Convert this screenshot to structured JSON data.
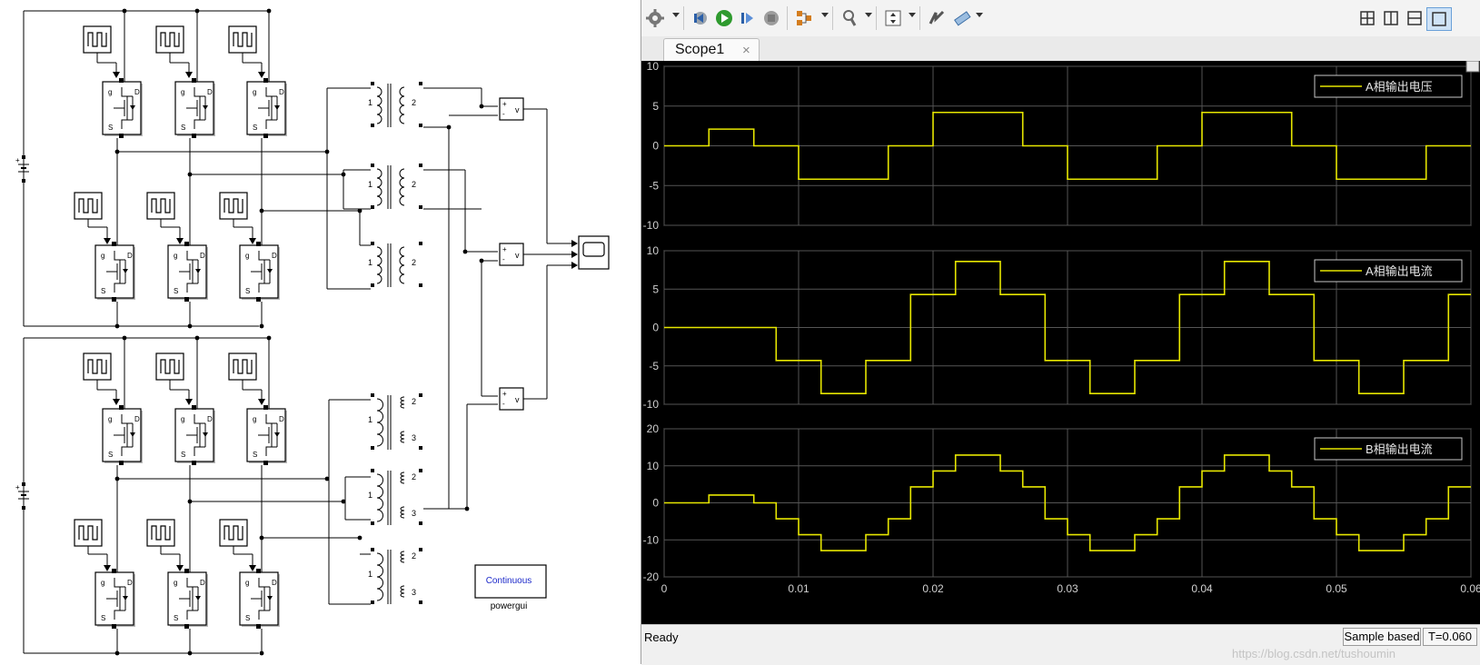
{
  "model": {
    "powergui": {
      "mode": "Continuous",
      "label": "powergui"
    },
    "transformer_ports": {
      "primary": "1",
      "secondary": "2",
      "tertiary": "3"
    },
    "measure_symbol": "v",
    "sum_signs": {
      "plus": "+",
      "minus": "-"
    },
    "mosfet_pins": {
      "gate": "g",
      "source": "S",
      "drain": "D"
    }
  },
  "scope": {
    "toolbar": {
      "icons": [
        "settings-icon",
        "step-back-icon",
        "run-icon",
        "step-forward-icon",
        "stop-icon",
        "signal-selector-icon",
        "zoom-icon",
        "autoscale-icon",
        "triggers-icon",
        "measurements-icon"
      ],
      "layout_icons": [
        "layout-2x2-icon",
        "layout-2cols-icon",
        "layout-2rows-icon",
        "layout-single-icon"
      ]
    },
    "tab": {
      "label": "Scope1",
      "close_icon": "×"
    },
    "status": {
      "state": "Ready",
      "mode": "Sample based",
      "time": "T=0.060"
    },
    "watermark": "https://blog.csdn.net/tushoumin"
  },
  "chart_data": [
    {
      "type": "line",
      "title": "",
      "legend": [
        "A相输出电压"
      ],
      "legend_position": "top-right",
      "xlim": [
        0,
        0.06
      ],
      "ylim": [
        -10,
        10
      ],
      "yticks": [
        -10,
        -5,
        0,
        5,
        10
      ],
      "xticks": [
        0,
        0.01,
        0.02,
        0.03,
        0.04,
        0.05,
        0.06
      ],
      "xticklabels_shown": false,
      "grid": true,
      "color": "#e6e600",
      "series": [
        {
          "name": "A相输出电压",
          "x": [
            0,
            0.00333,
            0.00667,
            0.01,
            0.01667,
            0.02,
            0.02667,
            0.03,
            0.03667,
            0.04,
            0.04667,
            0.05,
            0.05667,
            0.06
          ],
          "y": [
            0,
            2.1,
            0,
            -4.2,
            0,
            4.2,
            0,
            -4.2,
            0,
            4.2,
            0,
            -4.2,
            0,
            0
          ]
        }
      ]
    },
    {
      "type": "line",
      "title": "",
      "legend": [
        "A相输出电流"
      ],
      "legend_position": "top-right",
      "xlim": [
        0,
        0.06
      ],
      "ylim": [
        -10,
        10
      ],
      "yticks": [
        -10,
        -5,
        0,
        5,
        10
      ],
      "xticks": [
        0,
        0.01,
        0.02,
        0.03,
        0.04,
        0.05,
        0.06
      ],
      "xticklabels_shown": false,
      "grid": true,
      "color": "#e6e600",
      "series": [
        {
          "name": "A相输出电流",
          "x": [
            0,
            0.00833,
            0.01167,
            0.015,
            0.01833,
            0.02167,
            0.025,
            0.02833,
            0.03167,
            0.035,
            0.03833,
            0.04167,
            0.045,
            0.04833,
            0.05167,
            0.055,
            0.05833,
            0.06
          ],
          "y": [
            0,
            -4.3,
            -8.6,
            -4.3,
            4.3,
            8.6,
            4.3,
            -4.3,
            -8.6,
            -4.3,
            4.3,
            8.6,
            4.3,
            -4.3,
            -8.6,
            -4.3,
            4.3,
            4.3
          ]
        }
      ]
    },
    {
      "type": "line",
      "title": "",
      "legend": [
        "B相输出电流"
      ],
      "legend_position": "top-right",
      "xlim": [
        0,
        0.06
      ],
      "ylim": [
        -20,
        20
      ],
      "yticks": [
        -20,
        -10,
        0,
        10,
        20
      ],
      "xticks": [
        0,
        0.01,
        0.02,
        0.03,
        0.04,
        0.05,
        0.06
      ],
      "xticklabels": [
        "0",
        "0.01",
        "0.02",
        "0.03",
        "0.04",
        "0.05",
        "0.06"
      ],
      "xticklabels_shown": true,
      "grid": true,
      "color": "#e6e600",
      "series": [
        {
          "name": "B相输出电流",
          "x": [
            0,
            0.00333,
            0.00667,
            0.00833,
            0.01,
            0.01167,
            0.015,
            0.01667,
            0.01833,
            0.02,
            0.02167,
            0.025,
            0.02667,
            0.02833,
            0.03,
            0.03167,
            0.035,
            0.03667,
            0.03833,
            0.04,
            0.04167,
            0.045,
            0.04667,
            0.04833,
            0.05,
            0.05167,
            0.055,
            0.05667,
            0.05833,
            0.06
          ],
          "y": [
            0,
            2.1,
            0,
            -4.3,
            -8.6,
            -12.9,
            -8.6,
            -4.3,
            4.3,
            8.6,
            12.9,
            8.6,
            4.3,
            -4.3,
            -8.6,
            -12.9,
            -8.6,
            -4.3,
            4.3,
            8.6,
            12.9,
            8.6,
            4.3,
            -4.3,
            -8.6,
            -12.9,
            -8.6,
            -4.3,
            4.3,
            4.3
          ]
        }
      ]
    }
  ]
}
